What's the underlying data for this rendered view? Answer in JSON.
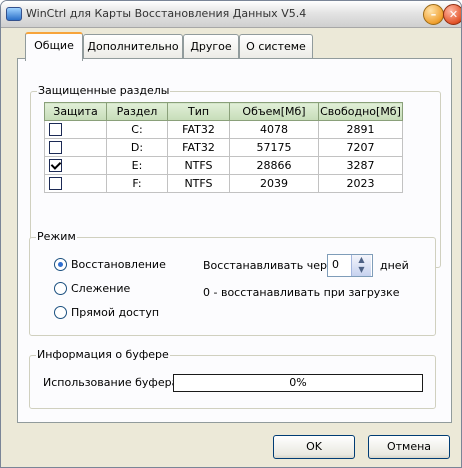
{
  "window": {
    "title": "WinCtrl для Карты Восстановления Данных V5.4"
  },
  "tabs": [
    {
      "label": "Общие",
      "active": true
    },
    {
      "label": "Дополнительно",
      "active": false
    },
    {
      "label": "Другое",
      "active": false
    },
    {
      "label": "О системе",
      "active": false
    }
  ],
  "partitions": {
    "group_title": "Защищенные разделы",
    "headers": [
      "Защита",
      "Раздел",
      "Тип",
      "Объем[Мб]",
      "Свободно[Мб]"
    ],
    "rows": [
      {
        "protected": false,
        "drive": "C:",
        "type": "FAT32",
        "size": "4078",
        "free": "2891"
      },
      {
        "protected": false,
        "drive": "D:",
        "type": "FAT32",
        "size": "57175",
        "free": "7207"
      },
      {
        "protected": true,
        "drive": "E:",
        "type": "NTFS",
        "size": "28866",
        "free": "3287"
      },
      {
        "protected": false,
        "drive": "F:",
        "type": "NTFS",
        "size": "2039",
        "free": "2023"
      }
    ]
  },
  "mode": {
    "group_title": "Режим",
    "options": [
      {
        "label": "Восстановление",
        "selected": true
      },
      {
        "label": "Слежение",
        "selected": false
      },
      {
        "label": "Прямой доступ",
        "selected": false
      }
    ],
    "restore_every_label": "Восстанавливать через",
    "restore_every_value": "0",
    "days_label": "дней",
    "hint": "0 - восстанавливать при загрузке"
  },
  "buffer": {
    "group_title": "Информация о буфере",
    "usage_label": "Использование буфера",
    "usage_text": "0%",
    "usage_fraction": 0
  },
  "buttons": {
    "ok": "OK",
    "cancel": "Отмена"
  },
  "icons": {
    "app": "app-icon",
    "minimize": "minimize-icon",
    "close": "close-icon",
    "spin": "spin-arrows-icon"
  }
}
